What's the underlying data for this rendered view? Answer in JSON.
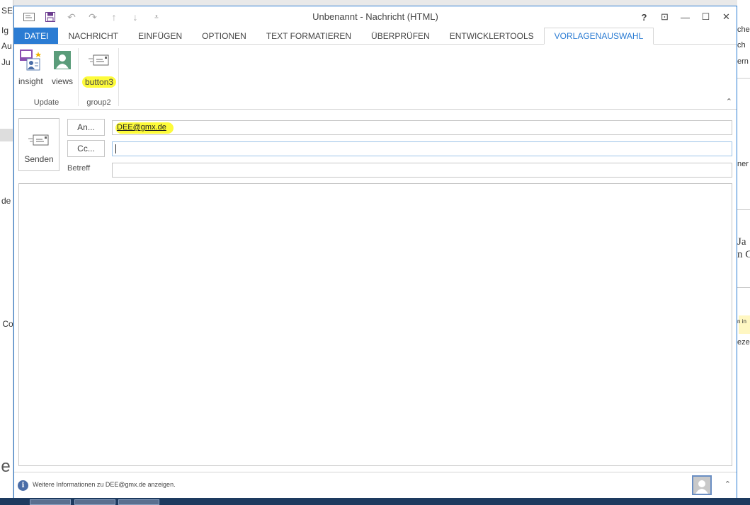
{
  "window": {
    "title": "Unbenannt - Nachricht (HTML)"
  },
  "titlebar_controls": {
    "help": "?",
    "restore_ribbon": "⊡",
    "minimize": "—",
    "maximize": "☐",
    "close": "✕"
  },
  "ribbon_tabs": [
    {
      "label": "DATEI",
      "state": "file"
    },
    {
      "label": "NACHRICHT",
      "state": ""
    },
    {
      "label": "EINFÜGEN",
      "state": ""
    },
    {
      "label": "OPTIONEN",
      "state": ""
    },
    {
      "label": "TEXT FORMATIEREN",
      "state": ""
    },
    {
      "label": "ÜBERPRÜFEN",
      "state": ""
    },
    {
      "label": "ENTWICKLERTOOLS",
      "state": ""
    },
    {
      "label": "VORLAGENAUSWAHL",
      "state": "active"
    }
  ],
  "ribbon": {
    "groups": [
      {
        "label": "Update",
        "buttons": [
          {
            "label": "insight",
            "icon": "insight-icon"
          },
          {
            "label": "views",
            "icon": "contact-card-icon"
          }
        ]
      },
      {
        "label": "group2",
        "buttons": [
          {
            "label": "button3",
            "icon": "envelope-icon",
            "highlighted": true
          }
        ]
      }
    ]
  },
  "compose": {
    "send_label": "Senden",
    "to_button": "An...",
    "cc_button": "Cc...",
    "subject_label": "Betreff",
    "to_value": "DEE@gmx.de",
    "cc_value": "",
    "subject_value": ""
  },
  "status": {
    "message": "Weitere Informationen zu DEE@gmx.de anzeigen."
  },
  "background": {
    "left_texts": [
      "SE",
      "Ig",
      "Au",
      "Ju",
      "de",
      "r Co"
    ],
    "right_texts": [
      "cher",
      "ch",
      "ern",
      "ner",
      "Ja",
      "n C",
      "n in",
      "ezei"
    ]
  },
  "colors": {
    "accent": "#2b7cd3",
    "highlight": "#fdfb3a"
  }
}
